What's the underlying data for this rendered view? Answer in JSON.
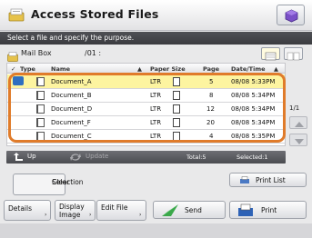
{
  "header": {
    "title": "Access Stored Files"
  },
  "instruction": "Select a file and specify the purpose.",
  "location": {
    "mailbox": "Mail Box",
    "path": "/01 :"
  },
  "table": {
    "columns": {
      "type": "Type",
      "name": "Name",
      "paper_size": "Paper Size",
      "page": "Page",
      "datetime": "Date/Time"
    },
    "rows": [
      {
        "name": "Document_A",
        "paper": "LTR",
        "page": "5",
        "datetime": "08/08 5:33PM"
      },
      {
        "name": "Document_B",
        "paper": "LTR",
        "page": "8",
        "datetime": "08/08 5:34PM"
      },
      {
        "name": "Document_D",
        "paper": "LTR",
        "page": "12",
        "datetime": "08/08 5:34PM"
      },
      {
        "name": "Document_F",
        "paper": "LTR",
        "page": "20",
        "datetime": "08/08 5:34PM"
      },
      {
        "name": "Document_C",
        "paper": "LTR",
        "page": "4",
        "datetime": "08/08 5:35PM"
      }
    ]
  },
  "pager": {
    "counter": "1/1"
  },
  "toolbar": {
    "up": "Up",
    "update": "Update",
    "total": "Total:5",
    "selected": "Selected:1"
  },
  "buttons": {
    "clear_line1": "Clear",
    "clear_line2": "Selection",
    "print_list": "Print List",
    "details": "Details",
    "display_line1": "Display",
    "display_line2": "Image",
    "edit": "Edit File",
    "send": "Send",
    "print": "Print"
  },
  "colors": {
    "accent": "#e07b2a",
    "selected_row": "#fdf4a0",
    "header_bar": "#3b3c40"
  }
}
